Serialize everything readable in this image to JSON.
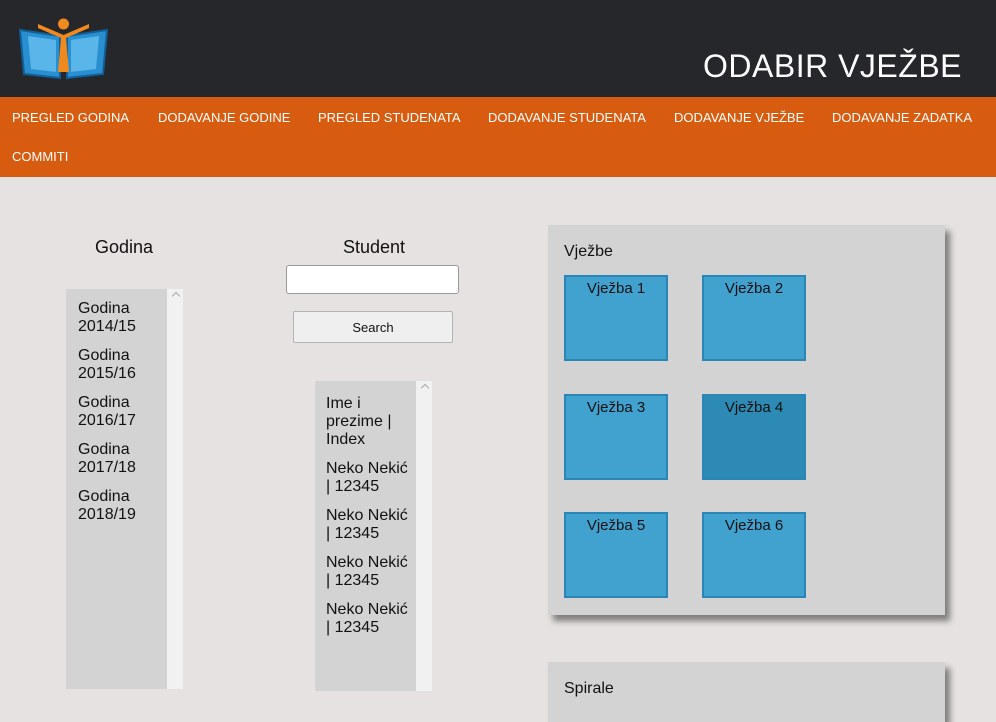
{
  "header": {
    "title": "ODABIR VJEŽBE"
  },
  "nav": {
    "items": [
      "PREGLED GODINA",
      "DODAVANJE GODINE",
      "PREGLED STUDENATA",
      "DODAVANJE STUDENATA",
      "DODAVANJE VJEŽBE",
      "DODAVANJE ZADATKA",
      "COMMITI"
    ]
  },
  "godina": {
    "heading": "Godina",
    "items": [
      [
        "Godina",
        "2014/15"
      ],
      [
        "Godina",
        "2015/16"
      ],
      [
        "Godina",
        "2016/17"
      ],
      [
        "Godina",
        "2017/18"
      ],
      [
        "Godina",
        "2018/19"
      ]
    ]
  },
  "student": {
    "heading": "Student",
    "search_value": "",
    "search_button": "Search",
    "items": [
      [
        "Ime i",
        "prezime |",
        "Index"
      ],
      [
        "Neko Nekić",
        "| 12345"
      ],
      [
        "Neko Nekić",
        "| 12345"
      ],
      [
        "Neko Nekić",
        "| 12345"
      ],
      [
        "Neko Nekić",
        "| 12345"
      ]
    ]
  },
  "vjezbe": {
    "title": "Vježbe",
    "tiles": [
      "Vježba 1",
      "Vježba 2",
      "Vježba 3",
      "Vježba 4",
      "Vježba 5",
      "Vježba 6"
    ],
    "active_tile": 3
  },
  "spirale": {
    "title": "Spirale"
  },
  "colors": {
    "header_bg": "#26272a",
    "nav_bg": "#d75c0f",
    "page_bg": "#e6e2e1",
    "tile": "#41a2cf",
    "tile_active": "#2c8ab5"
  }
}
